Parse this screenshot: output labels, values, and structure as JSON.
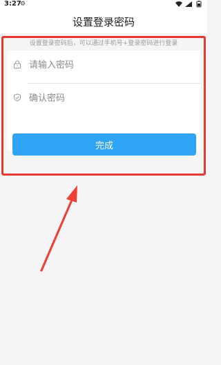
{
  "status_bar": {
    "time": "3:27",
    "gear_icon": "gear-icon",
    "wifi_icon": "wifi-icon",
    "signal_icon": "signal-icon",
    "battery_icon": "battery-icon"
  },
  "header": {
    "title": "设置登录密码"
  },
  "form": {
    "hint": "设置登录密码后，可以通过手机号+登录密码进行登录",
    "password": {
      "value": "",
      "placeholder": "请输入密码",
      "icon": "lock-icon"
    },
    "confirm": {
      "value": "",
      "placeholder": "确认密码",
      "icon": "shield-check-icon"
    },
    "submit_label": "完成"
  },
  "colors": {
    "accent": "#2fa3f5",
    "highlight": "#e8372f",
    "background": "#f5f5f7"
  }
}
